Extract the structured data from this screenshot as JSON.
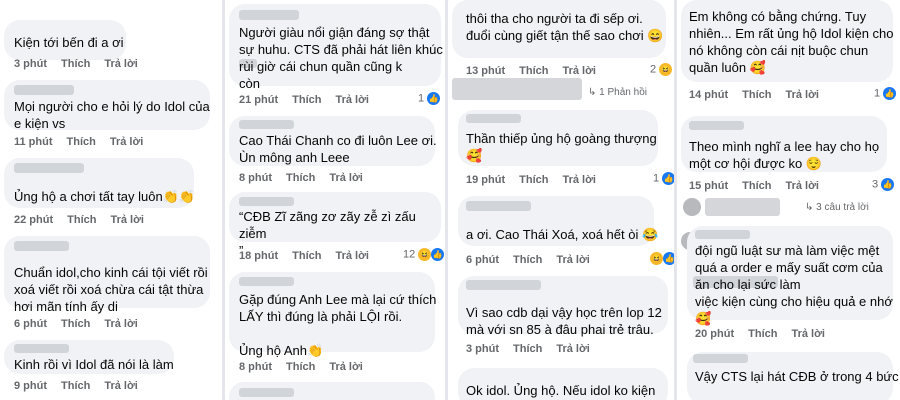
{
  "actions": {
    "like": "Thích",
    "reply": "Trả lời"
  },
  "col1": [
    {
      "text": "Kiện tới bến đi a ơi",
      "time": "3 phút"
    },
    {
      "text": "Mọi người cho e hỏi lý do Idol của\ne kiện vs",
      "time": "11 phút"
    },
    {
      "text": "Ủng hộ a chơi tất tay luôn👏👏",
      "time": "22 phút"
    },
    {
      "text": "Chuẩn idol,cho kinh cái tội viết rồi\nxoá viết rồi xoá chừa cái tật thừa\nhơi mãn tính ấy di",
      "time": "6 phút"
    },
    {
      "text": "Kinh rồi vì Idol đã nói là làm",
      "time": "9 phút"
    }
  ],
  "col2": [
    {
      "text": "Người giàu nổi giận đáng sợ thật\nsự huhu. CTS đã phải hát liên khúc\n     rùi giờ cái chun quần cũng k\ncòn",
      "time": "21 phút",
      "count": "1"
    },
    {
      "text": "Cao Thái Chanh co đi luôn Lee ơi.\nÙn mông anh Leee",
      "time": "8 phút"
    },
    {
      "text": "“CĐB Zĩ zãng zơ zãy zễ zì zấu ziễm\n”",
      "time": "18 phút",
      "count": "12"
    },
    {
      "text": "Gặp đúng Anh Lee mà lại cứ thích\nLẤY thì đúng là phải LỘI rồi.\n\nỦng hộ Anh👏",
      "time": "8 phút"
    }
  ],
  "col3": [
    {
      "text": "thôi tha cho người ta đi sếp ơi.\nđuổi cùng giết tận thế sao chơi 😄",
      "time": "13 phút",
      "count": "2"
    },
    {
      "reply_count": "1 Phản hồi"
    },
    {
      "text": "Thần thiếp ủng hộ goàng thượng\n🥰",
      "time": "19 phút",
      "count": "1"
    },
    {
      "text": "a ơi. Cao Thái Xoá, xoá hết òi 😂",
      "time": "6 phút"
    },
    {
      "text": "Vì sao cdb dại vậy học trên lop  12\nmà với sn 85 à đâu phai trẻ trâu.",
      "time": "3 phút"
    },
    {
      "text": "Ok idol. Ủng hộ.  Nếu idol ko kiện"
    }
  ],
  "col4": [
    {
      "text": "Em không có bằng chứng. Tuy\nnhiên... Em rất ủng hộ Idol kiện cho\nnó không còn cái nịt buộc chun\nquần luôn 🥰",
      "time": "14 phút",
      "count": "1"
    },
    {
      "text": "Theo mình nghĩ a lee hay cho họ\nmột cơ hội được ko 😌",
      "time": "15 phút",
      "count": "3"
    },
    {
      "reply_count": "3 câu trả lời"
    },
    {
      "text": "đội ngũ luật sư mà làm việc mệt\nquá a order e mấy suất cơm của\n                  ăn cho lại sức làm\nviệc kiện cùng cho hiệu quả e nhớ\n🥰",
      "time": "20 phút"
    },
    {
      "text": "Vậy CTS lại hát CĐB ở trong 4 bức"
    }
  ]
}
